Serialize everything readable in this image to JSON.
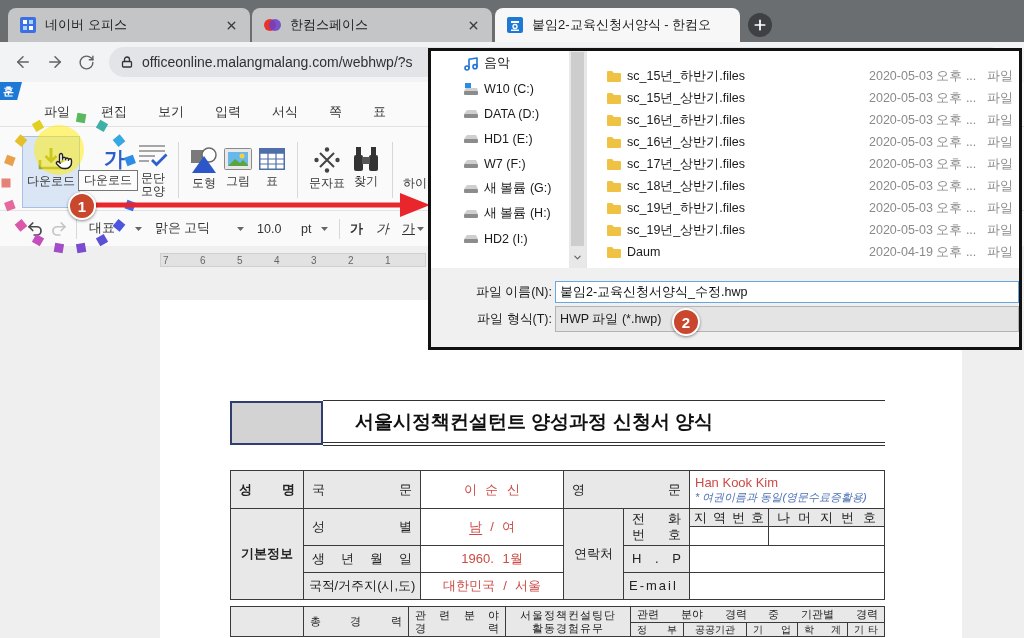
{
  "browser": {
    "tabs": [
      {
        "title": "네이버 오피스",
        "selected": false,
        "close_button": true
      },
      {
        "title": "한컴스페이스",
        "selected": false,
        "close_button": true
      },
      {
        "title": "붙임2-교육신청서양식 - 한컴오",
        "selected": true,
        "close_button": false
      }
    ],
    "address": "officeonline.malangmalang.com/webhwp/?s"
  },
  "app": {
    "logo": "훈",
    "menu": [
      "파일",
      "편집",
      "보기",
      "입력",
      "서식",
      "쪽",
      "표"
    ],
    "toolbar": [
      {
        "kind": "download",
        "label": "다운로드",
        "selected": true
      },
      {
        "kind": "glyph",
        "glyph": "가",
        "selected": false
      },
      {
        "kind": "paragraph",
        "label": "문단 모양",
        "selected": false
      },
      {
        "kind": "shape",
        "label": "도형",
        "selected": false
      },
      {
        "kind": "picture",
        "label": "그림",
        "selected": false
      },
      {
        "kind": "table",
        "label": "표",
        "selected": false
      },
      {
        "kind": "symbol",
        "label": "문자표",
        "selected": false
      },
      {
        "kind": "find",
        "label": "찾기",
        "selected": false
      },
      {
        "kind": "link",
        "label": "하이",
        "selected": false
      }
    ],
    "tooltip": "다운로드",
    "format_bar": {
      "history": [
        {
          "kind": "undo",
          "disabled": false
        },
        {
          "kind": "redo",
          "disabled": true
        }
      ],
      "style": "대표",
      "font": "맑은 고딕",
      "size": "10.0",
      "unit": "pt",
      "text_styles": [
        {
          "kind": "bold",
          "glyph": "가"
        },
        {
          "kind": "italic",
          "glyph": "가"
        },
        {
          "kind": "underline",
          "glyph": "가"
        }
      ]
    },
    "ruler": [
      "7",
      "6",
      "5",
      "4",
      "3",
      "2",
      "1"
    ]
  },
  "document": {
    "title": "서울시정책컨설턴트 양성과정 신청서 양식",
    "applicant_table": {
      "cells": [
        {
          "kind": "heading",
          "text": "성 명"
        },
        {
          "kind": "label",
          "text": "국 문"
        },
        {
          "kind": "value",
          "text": "이 순 신"
        },
        {
          "kind": "label",
          "text": "영 문"
        },
        {
          "kind": "value",
          "text": "Han Kook Kim",
          "note": "* 여권이름과 동일(영문수료증활용)"
        },
        {
          "kind": "heading",
          "text": "기본정보"
        },
        {
          "kind": "label",
          "text": "성 별"
        },
        {
          "kind": "choice",
          "options": [
            {
              "label": "남",
              "selected": true
            },
            {
              "label": "여",
              "selected": false
            }
          ],
          "separator": "/"
        },
        {
          "kind": "label",
          "text": "연락처"
        },
        {
          "kind": "label",
          "text": "전 화\n번 호"
        },
        {
          "kind": "label",
          "text": "지 역 번 호"
        },
        {
          "kind": "label",
          "text": "나 머 지 번 호"
        },
        {
          "kind": "blank"
        },
        {
          "kind": "blank"
        },
        {
          "kind": "label",
          "text": "생 년 월 일"
        },
        {
          "kind": "value",
          "text": "1960. 1월"
        },
        {
          "kind": "label",
          "text": "H . P"
        },
        {
          "kind": "blank"
        },
        {
          "kind": "label",
          "text": "국적/거주지(시,도)"
        },
        {
          "kind": "value",
          "text": "대한민국 / 서울"
        },
        {
          "kind": "label",
          "text": "E-mail"
        },
        {
          "kind": "blank"
        }
      ]
    },
    "career_table": {
      "headers": [
        {
          "kind": "blank"
        },
        {
          "kind": "label",
          "text": "총 경 력"
        },
        {
          "kind": "label",
          "text": "관 련 분 야\n경 력"
        },
        {
          "kind": "label",
          "text": "서울정책컨설팅단\n활동경험유무"
        },
        {
          "kind": "label",
          "text": "관련 분야 경력 중 기관별 경력"
        }
      ],
      "sub_headers": [
        "정 부",
        "공공기관",
        "기 업",
        "학 계",
        "기 타"
      ]
    }
  },
  "save_dialog": {
    "nav_items": [
      {
        "kind": "music",
        "label": "음악"
      },
      {
        "kind": "system_drive",
        "label": "W10 (C:)"
      },
      {
        "kind": "drive",
        "label": "DATA (D:)"
      },
      {
        "kind": "drive",
        "label": "HD1 (E:)"
      },
      {
        "kind": "drive",
        "label": "W7 (F:)"
      },
      {
        "kind": "drive",
        "label": "새 볼륨 (G:)"
      },
      {
        "kind": "drive",
        "label": "새 볼륨 (H:)"
      },
      {
        "kind": "drive",
        "label": "HD2 (I:)"
      }
    ],
    "files": [
      {
        "name": "sc_15년_하반기.files",
        "modified": "2020-05-03 오후 ...",
        "type": "파일"
      },
      {
        "name": "sc_15년_상반기.files",
        "modified": "2020-05-03 오후 ...",
        "type": "파일"
      },
      {
        "name": "sc_16년_하반기.files",
        "modified": "2020-05-03 오후 ...",
        "type": "파일"
      },
      {
        "name": "sc_16년_상반기.files",
        "modified": "2020-05-03 오후 ...",
        "type": "파일"
      },
      {
        "name": "sc_17년_상반기.files",
        "modified": "2020-05-03 오후 ...",
        "type": "파일"
      },
      {
        "name": "sc_18년_상반기.files",
        "modified": "2020-05-03 오후 ...",
        "type": "파일"
      },
      {
        "name": "sc_19년_하반기.files",
        "modified": "2020-05-03 오후 ...",
        "type": "파일"
      },
      {
        "name": "sc_19년_상반기.files",
        "modified": "2020-05-03 오후 ...",
        "type": "파일"
      },
      {
        "name": "Daum",
        "modified": "2020-04-19 오후 ...",
        "type": "파일"
      }
    ],
    "file_name": {
      "label": "파일 이름(N):",
      "value": "붙임2-교육신청서양식_수정.hwp"
    },
    "file_type": {
      "label": "파일 형식(T):",
      "value": "HWP 파일 (*.hwp)"
    }
  },
  "annotations": {
    "step_badges": [
      "1",
      "2"
    ]
  }
}
